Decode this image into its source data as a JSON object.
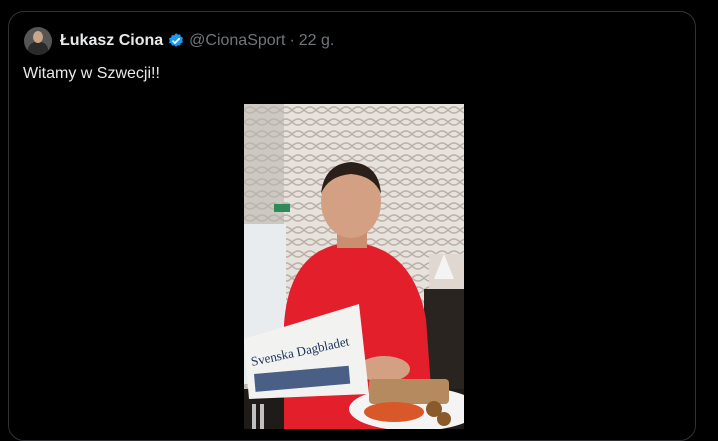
{
  "tweet": {
    "author_name": "Łukasz Ciona",
    "handle": "@CionaSport",
    "separator": "·",
    "time": "22 g.",
    "text": "Witamy w Szwecji!!",
    "verified_icon": "verified-badge-icon"
  },
  "media": {
    "newspaper_title": "Svenska Dagbladet"
  },
  "colors": {
    "background": "#000000",
    "border": "#2f3336",
    "text_primary": "#e7e9ea",
    "text_secondary": "#71767b",
    "verified": "#1d9bf0"
  }
}
